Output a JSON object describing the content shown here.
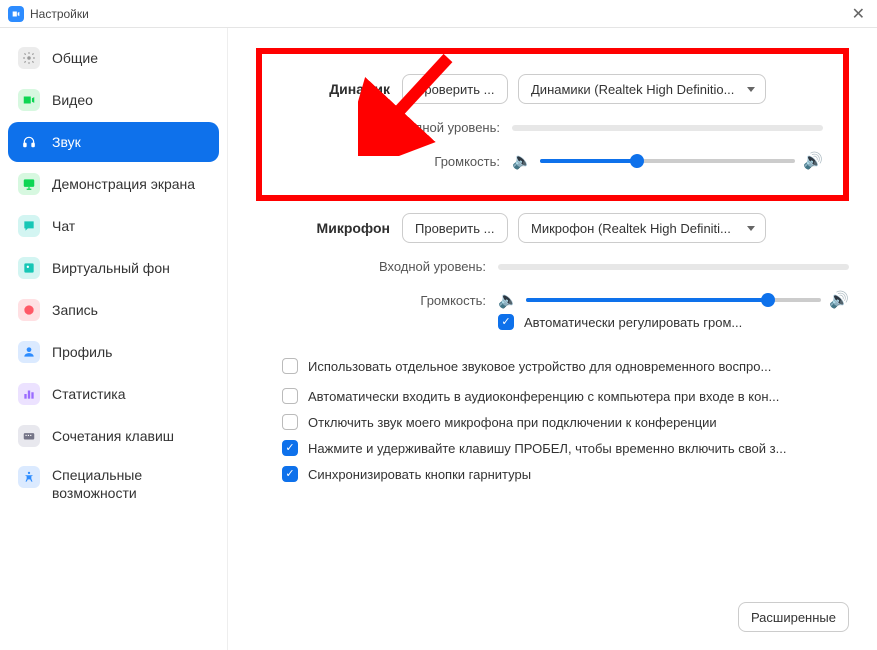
{
  "title": "Настройки",
  "sidebar": {
    "items": [
      {
        "label": "Общие",
        "icon": "gear",
        "color": "#b8b8b8"
      },
      {
        "label": "Видео",
        "icon": "video",
        "color": "#0dd653"
      },
      {
        "label": "Звук",
        "icon": "headphones",
        "color": "#ffffff"
      },
      {
        "label": "Демонстрация экрана",
        "icon": "share",
        "color": "#0dd653"
      },
      {
        "label": "Чат",
        "icon": "chat",
        "color": "#17c7b6"
      },
      {
        "label": "Виртуальный фон",
        "icon": "vb",
        "color": "#17c7b6"
      },
      {
        "label": "Запись",
        "icon": "record",
        "color": "#ff5967"
      },
      {
        "label": "Профиль",
        "icon": "profile",
        "color": "#2d8cff"
      },
      {
        "label": "Статистика",
        "icon": "stats",
        "color": "#9b6cff"
      },
      {
        "label": "Сочетания клавиш",
        "icon": "keyboard",
        "color": "#747487"
      },
      {
        "label": "Специальные возможности",
        "icon": "accessibility",
        "color": "#2d8cff"
      }
    ]
  },
  "speaker": {
    "title": "Динамик",
    "test_btn": "Проверить ...",
    "dropdown": "Динамики (Realtek High Definitio...",
    "output_label": "Выходной уровень:",
    "volume_label": "Громкость:",
    "volume_pct": 38
  },
  "mic": {
    "title": "Микрофон",
    "test_btn": "Проверить ...",
    "dropdown": "Микрофон (Realtek High Definiti...",
    "input_label": "Входной уровень:",
    "volume_label": "Громкость:",
    "volume_pct": 82,
    "auto_adjust": "Автоматически регулировать гром..."
  },
  "options": {
    "opt1": "Использовать отдельное звуковое устройство для одновременного воспро...",
    "opt2": "Автоматически входить в аудиоконференцию с компьютера при входе в кон...",
    "opt3": "Отключить звук моего микрофона при подключении к конференции",
    "opt4": "Нажмите и удерживайте клавишу ПРОБЕЛ, чтобы временно включить свой з...",
    "opt5": "Синхронизировать кнопки гарнитуры"
  },
  "advanced_btn": "Расширенные"
}
